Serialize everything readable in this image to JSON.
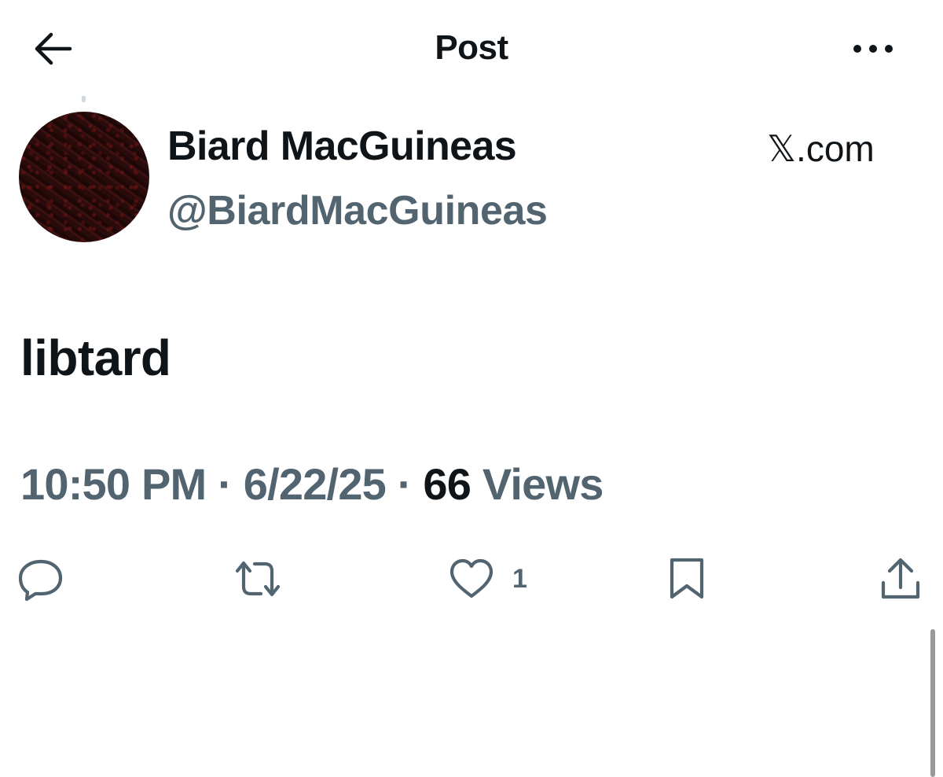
{
  "header": {
    "title": "Post",
    "back_icon": "arrow-left-icon",
    "more_icon": "more-horizontal-icon"
  },
  "author": {
    "display_name": "Biard MacGuineas",
    "handle": "@BiardMacGuineas",
    "source": "𝕏.com"
  },
  "post": {
    "text": "libtard"
  },
  "meta": {
    "time": "10:50 PM",
    "separator": " · ",
    "date": "6/22/25",
    "views_count": "66",
    "views_label": " Views"
  },
  "actions": {
    "reply_icon": "reply-icon",
    "repost_icon": "repost-icon",
    "like_icon": "heart-icon",
    "like_count": "1",
    "bookmark_icon": "bookmark-icon",
    "share_icon": "share-icon"
  },
  "colors": {
    "text_primary": "#0f1419",
    "text_secondary": "#536471",
    "background": "#ffffff"
  }
}
